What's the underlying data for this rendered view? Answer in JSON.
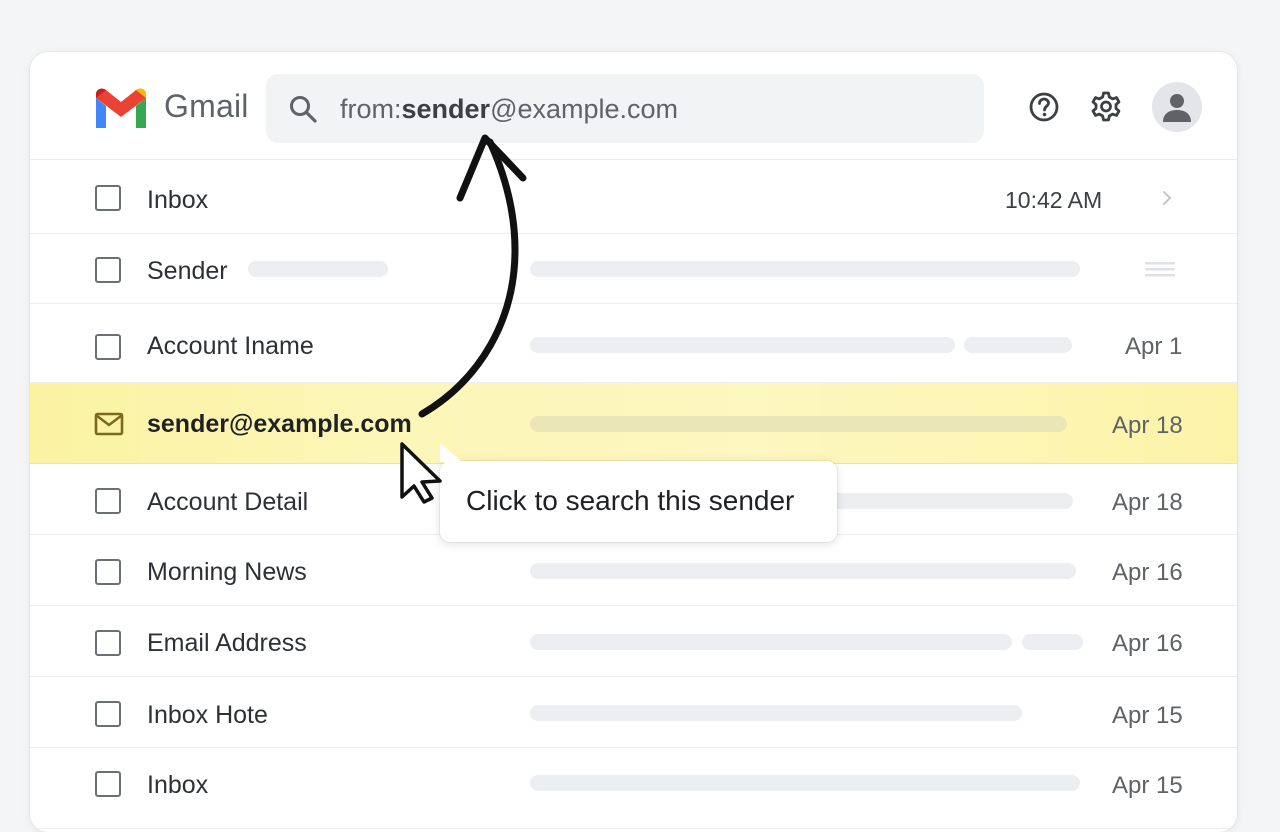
{
  "header": {
    "brand": "Gmail",
    "search": {
      "prefix": "from:",
      "bold": "sender",
      "suffix": "@example.com"
    },
    "icons": [
      "help-icon",
      "settings-gear-icon",
      "account-avatar-icon"
    ]
  },
  "rows": [
    {
      "name": "Inbox",
      "time": "10:42 AM"
    },
    {
      "name": "Sender"
    },
    {
      "name": "Account Iname",
      "date": "Apr 1"
    },
    {
      "name": "sender@example.com",
      "date": "Apr 18"
    },
    {
      "name": "Account Detail",
      "date": "Apr 18"
    },
    {
      "name": "Morning News",
      "date": "Apr 16"
    },
    {
      "name": "Email Address",
      "date": "Apr 16"
    },
    {
      "name": "Inbox Hote",
      "date": "Apr 15"
    },
    {
      "name": "Inbox",
      "date": "Apr 15"
    }
  ],
  "tooltip": {
    "text": "Click to search this sender"
  },
  "colors": {
    "highlight": "#fcf6b8",
    "gmail_red": "#ea4335",
    "gmail_blue": "#4285f4",
    "gmail_green": "#34a853",
    "gmail_yellow": "#fbbc04"
  }
}
